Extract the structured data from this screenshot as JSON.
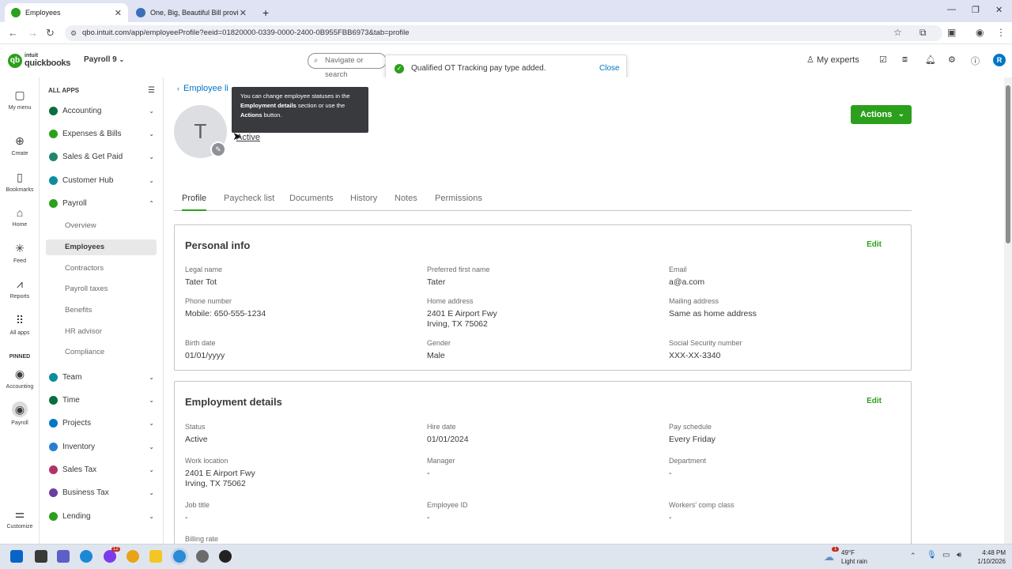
{
  "browser": {
    "tabs": [
      {
        "title": "Employees",
        "active": true
      },
      {
        "title": "One, Big, Beautiful Bill provisio",
        "active": false
      }
    ],
    "new_tab": "+",
    "url": "qbo.intuit.com/app/employeeProfile?eeid=01820000-0339-0000-2400-0B955FBB6973&tab=profile",
    "window_controls": [
      "—",
      "❐",
      "✕"
    ]
  },
  "header": {
    "logo_line1": "intuit",
    "logo_line2": "quickbooks",
    "company": "Payroll 9",
    "search_placeholder": "Navigate or search",
    "my_experts": "My experts",
    "user_initial": "R"
  },
  "toast": {
    "message": "Qualified OT Tracking pay type added.",
    "close": "Close"
  },
  "rail": [
    {
      "label": "My menu",
      "icon": "▢"
    },
    {
      "label": "Create",
      "icon": "⊕"
    },
    {
      "label": "Bookmarks",
      "icon": "▭"
    },
    {
      "label": "Home",
      "icon": "⌂"
    },
    {
      "label": "Feed",
      "icon": "✳"
    },
    {
      "label": "Reports",
      "icon": "⩘"
    },
    {
      "label": "All apps",
      "icon": "⠿"
    },
    {
      "label": "PINNED",
      "icon": ""
    },
    {
      "label": "Accounting",
      "icon": "◉"
    },
    {
      "label": "Payroll",
      "icon": "◉"
    },
    {
      "label": "Customize",
      "icon": "⚌"
    }
  ],
  "sidebar": {
    "heading": "ALL APPS",
    "items": [
      {
        "label": "Accounting",
        "color": "#0a6e3f"
      },
      {
        "label": "Expenses & Bills",
        "color": "#2ca01c"
      },
      {
        "label": "Sales & Get Paid",
        "color": "#21866e"
      },
      {
        "label": "Customer Hub",
        "color": "#0d8c9b"
      },
      {
        "label": "Payroll",
        "color": "#2ca01c"
      },
      {
        "label": "Team",
        "color": "#0d8c9b"
      },
      {
        "label": "Time",
        "color": "#0a6e3f"
      },
      {
        "label": "Projects",
        "color": "#0077c5"
      },
      {
        "label": "Inventory",
        "color": "#2a7ed1"
      },
      {
        "label": "Sales Tax",
        "color": "#b0336a"
      },
      {
        "label": "Business Tax",
        "color": "#6b3fa0"
      },
      {
        "label": "Lending",
        "color": "#2ca01c"
      }
    ],
    "payroll_sub": [
      "Overview",
      "Employees",
      "Contractors",
      "Payroll taxes",
      "Benefits",
      "HR advisor",
      "Compliance"
    ]
  },
  "profile": {
    "back_link": "Employee li",
    "initial": "T",
    "status": "Active",
    "tooltip_1": "You can change employee statuses in the ",
    "tooltip_bold1": "Employment details",
    "tooltip_2": " section or use the ",
    "tooltip_bold2": "Actions",
    "tooltip_3": " button.",
    "actions_button": "Actions",
    "tabs": [
      "Profile",
      "Paycheck list",
      "Documents",
      "History",
      "Notes",
      "Permissions"
    ]
  },
  "personal_info": {
    "title": "Personal info",
    "edit": "Edit",
    "fields": [
      {
        "label": "Legal name",
        "value": "Tater Tot"
      },
      {
        "label": "Preferred first name",
        "value": "Tater"
      },
      {
        "label": "Email",
        "value": "a@a.com"
      },
      {
        "label": "Phone number",
        "value": "Mobile: 650-555-1234"
      },
      {
        "label": "Home address",
        "value": "2401 E Airport Fwy",
        "value2": "Irving, TX 75062"
      },
      {
        "label": "Mailing address",
        "value": "Same as home address"
      },
      {
        "label": "Birth date",
        "value": "01/01/yyyy"
      },
      {
        "label": "Gender",
        "value": "Male"
      },
      {
        "label": "Social Security number",
        "value": "XXX-XX-3340"
      }
    ]
  },
  "employment": {
    "title": "Employment details",
    "edit": "Edit",
    "fields": [
      {
        "label": "Status",
        "value": "Active"
      },
      {
        "label": "Hire date",
        "value": "01/01/2024"
      },
      {
        "label": "Pay schedule",
        "value": "Every Friday"
      },
      {
        "label": "Work location",
        "value": "2401 E Airport Fwy",
        "value2": "Irving, TX 75062"
      },
      {
        "label": "Manager",
        "value": "-"
      },
      {
        "label": "Department",
        "value": "-"
      },
      {
        "label": "Job title",
        "value": "-"
      },
      {
        "label": "Employee ID",
        "value": "-"
      },
      {
        "label": "Workers' comp class",
        "value": "-"
      },
      {
        "label": "Billing rate",
        "value": ""
      }
    ]
  },
  "taskbar": {
    "weather_temp": "49°F",
    "weather_desc": "Light rain",
    "weather_badge": "1",
    "chat_badge": "12",
    "time": "4:48 PM",
    "date": "1/10/2026"
  }
}
